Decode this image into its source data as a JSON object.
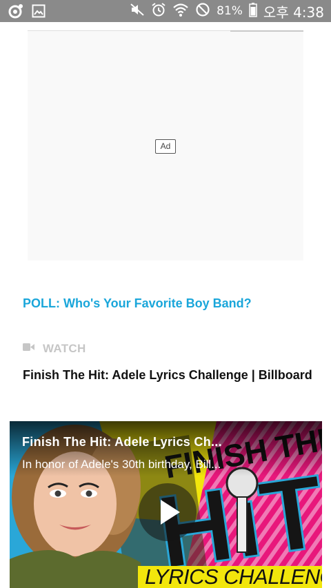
{
  "status_bar": {
    "battery_percent": "81%",
    "time": "오후 4:38",
    "icons": [
      "camera-circle-icon",
      "image-icon",
      "mute-icon",
      "alarm-icon",
      "wifi-icon",
      "do-not-disturb-icon",
      "battery-icon"
    ]
  },
  "ad": {
    "badge_label": "Ad"
  },
  "poll": {
    "label": "POLL: Who's Your Favorite Boy Band?"
  },
  "watch": {
    "label": "WATCH",
    "icon": "video-camera-icon"
  },
  "video": {
    "heading": "Finish The Hit: Adele Lyrics Challenge | Billboard",
    "overlay_title": "Finish The Hit: Adele Lyrics Ch...",
    "overlay_description": "In honor of Adele's 30th birthday, Bill...",
    "thumbnail_text": "LYRICS CHALLENGE",
    "thumbnail_art_text": "FINISH THE HIT"
  },
  "colors": {
    "status_bar": "#8a8a8a",
    "link": "#1aa6da",
    "watch_label": "#c6c6c6",
    "thumbnail_yellow": "#f2e60c",
    "thumbnail_pink": "#e8177b"
  }
}
